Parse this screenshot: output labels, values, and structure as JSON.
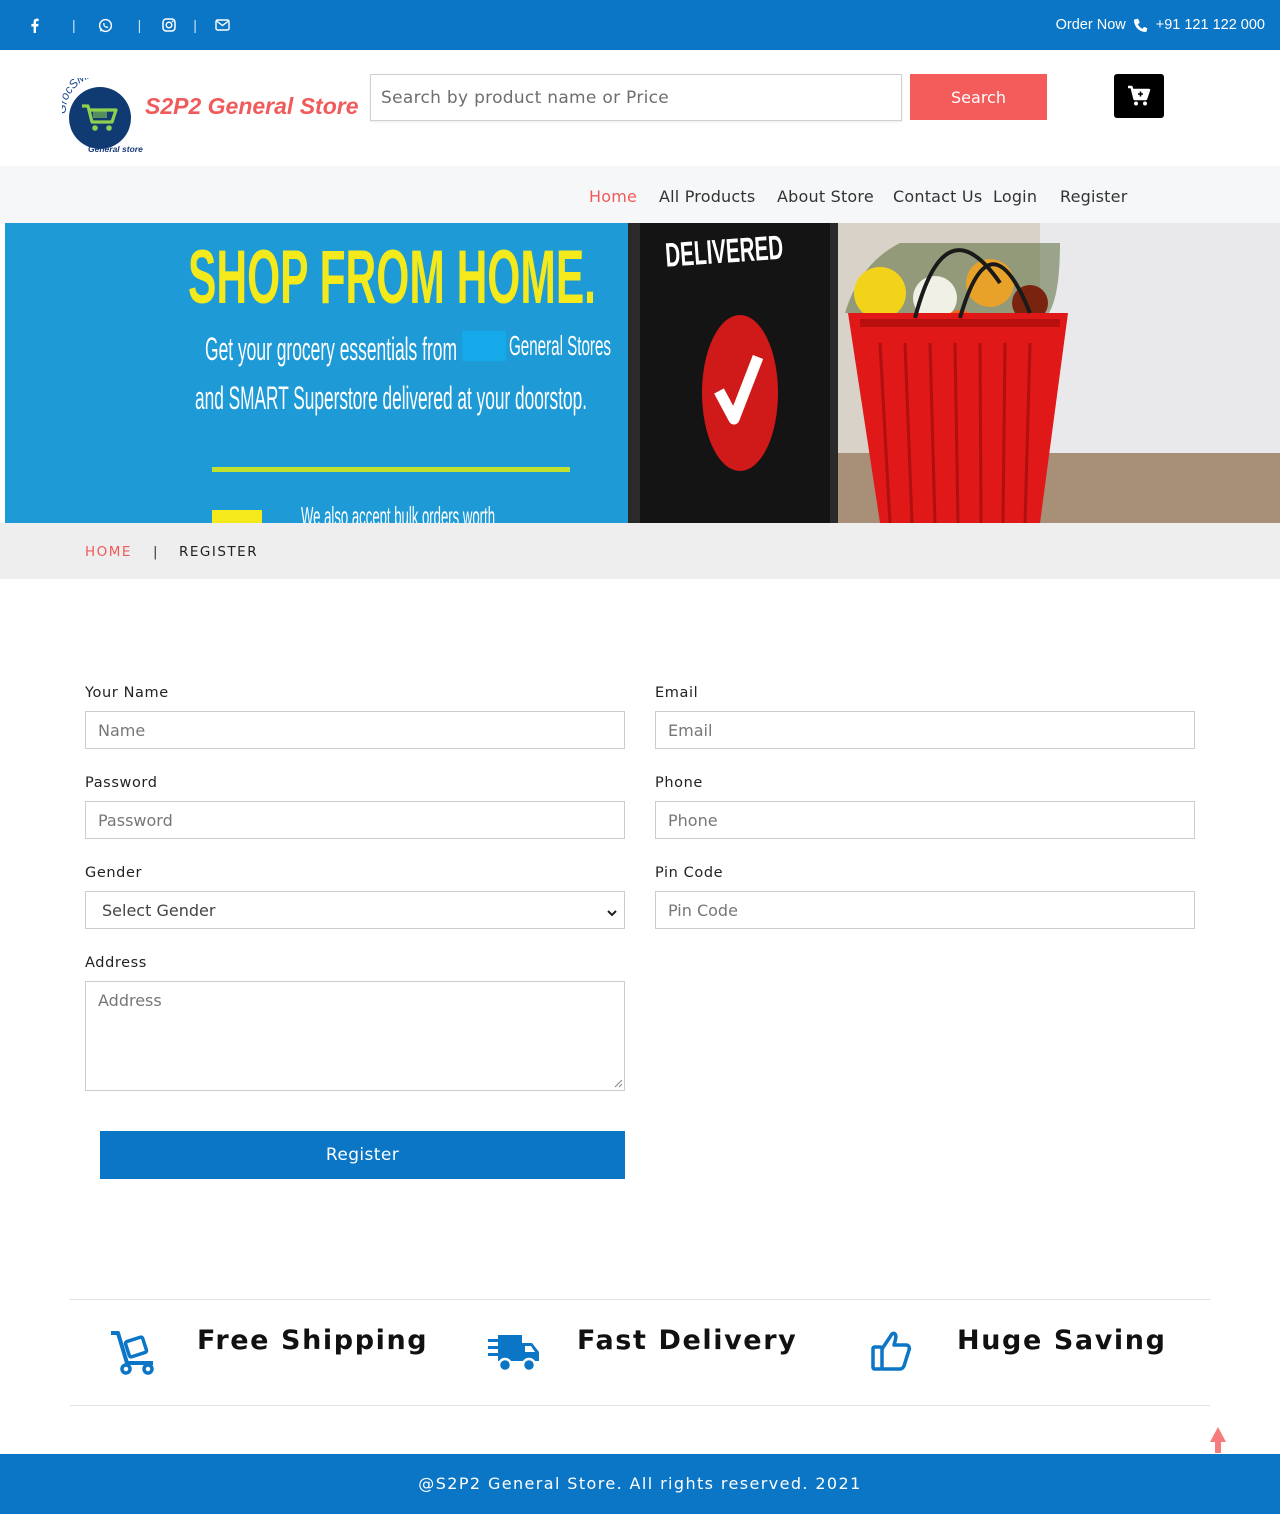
{
  "topbar": {
    "social_icons": [
      "facebook-icon",
      "whatsapp-icon",
      "instagram-icon",
      "envelope-icon"
    ],
    "separator": "|",
    "order_label": "Order Now",
    "phone": "+91 121 122 000"
  },
  "header": {
    "logo_text_top": "GrocSMART",
    "logo_text_bottom": "General store",
    "brand": "S2P2 General Store",
    "search_placeholder": "Search by product name or Price",
    "search_button": "Search",
    "cart_icon": "cart-icon"
  },
  "nav": {
    "items": [
      {
        "label": "Home",
        "active": true
      },
      {
        "label": "All Products",
        "active": false
      },
      {
        "label": "About Store",
        "active": false
      },
      {
        "label": "Contact Us",
        "active": false
      },
      {
        "label": "Login",
        "active": false
      },
      {
        "label": "Register",
        "active": false
      }
    ]
  },
  "banner": {
    "headline": "SHOP FROM HOME.",
    "line1": "Get your grocery essentials from",
    "line1b": "General Stores",
    "line2": "and SMART Superstore delivered at your doorstop.",
    "line3": "We also accept bulk orders worth",
    "sign": "DELIVERED"
  },
  "breadcrumb": {
    "home": "HOME",
    "separator": "|",
    "current": "REGISTER"
  },
  "form": {
    "name_label": "Your Name",
    "name_placeholder": "Name",
    "email_label": "Email",
    "email_placeholder": "Email",
    "password_label": "Password",
    "password_placeholder": "Password",
    "phone_label": "Phone",
    "phone_placeholder": "Phone",
    "gender_label": "Gender",
    "gender_value": "Select Gender",
    "pincode_label": "Pin Code",
    "pincode_placeholder": "Pin Code",
    "address_label": "Address",
    "address_placeholder": "Address",
    "submit": "Register"
  },
  "features": [
    {
      "icon": "dolly-icon",
      "label": "Free Shipping"
    },
    {
      "icon": "truck-icon",
      "label": "Fast Delivery"
    },
    {
      "icon": "thumbs-up-icon",
      "label": "Huge Saving"
    }
  ],
  "footer": {
    "copyright": "@S2P2 General Store. All rights reserved. 2021"
  },
  "colors": {
    "primary_blue": "#0b76c5",
    "accent_red": "#f45b5b"
  }
}
